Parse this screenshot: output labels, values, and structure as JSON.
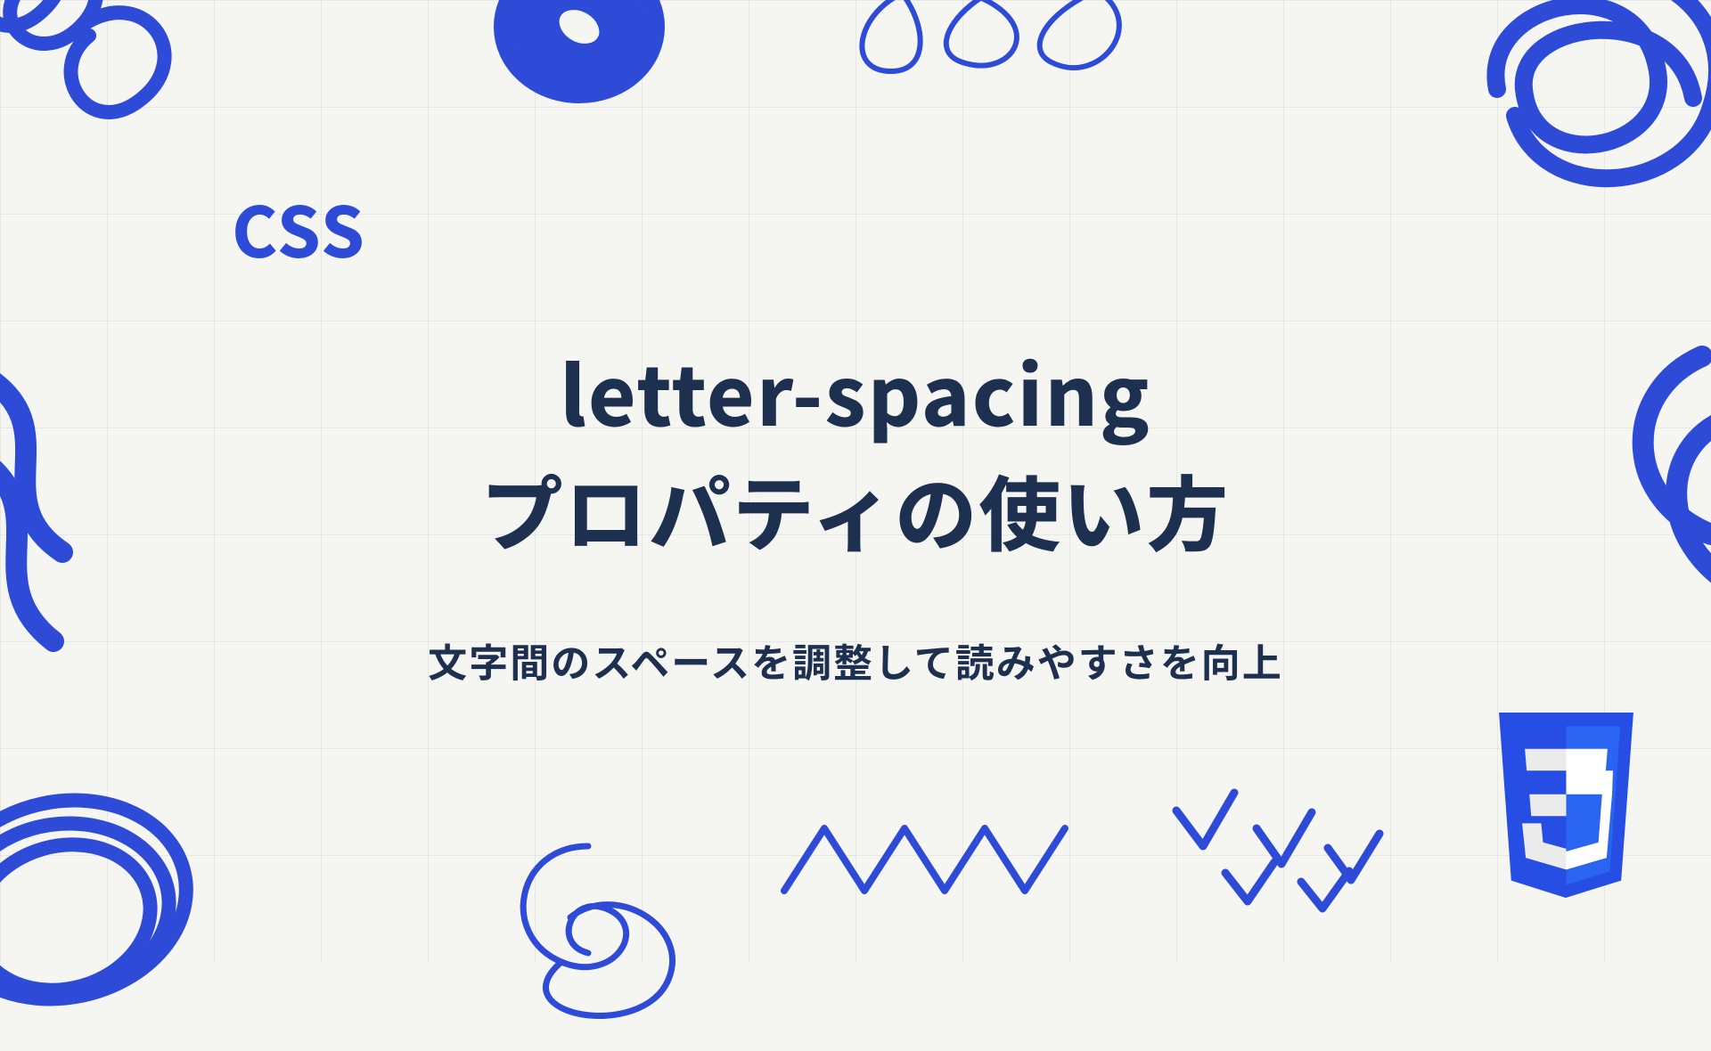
{
  "label": "CSS",
  "title_line1": "letter-spacing",
  "title_line2": "プロパティの使い方",
  "subtitle": "文字間のスペースを調整して読みやすさを向上",
  "colors": {
    "accent": "#2e4bd8",
    "text": "#1e3050",
    "bg": "#f5f5f2"
  },
  "logo": "css3"
}
